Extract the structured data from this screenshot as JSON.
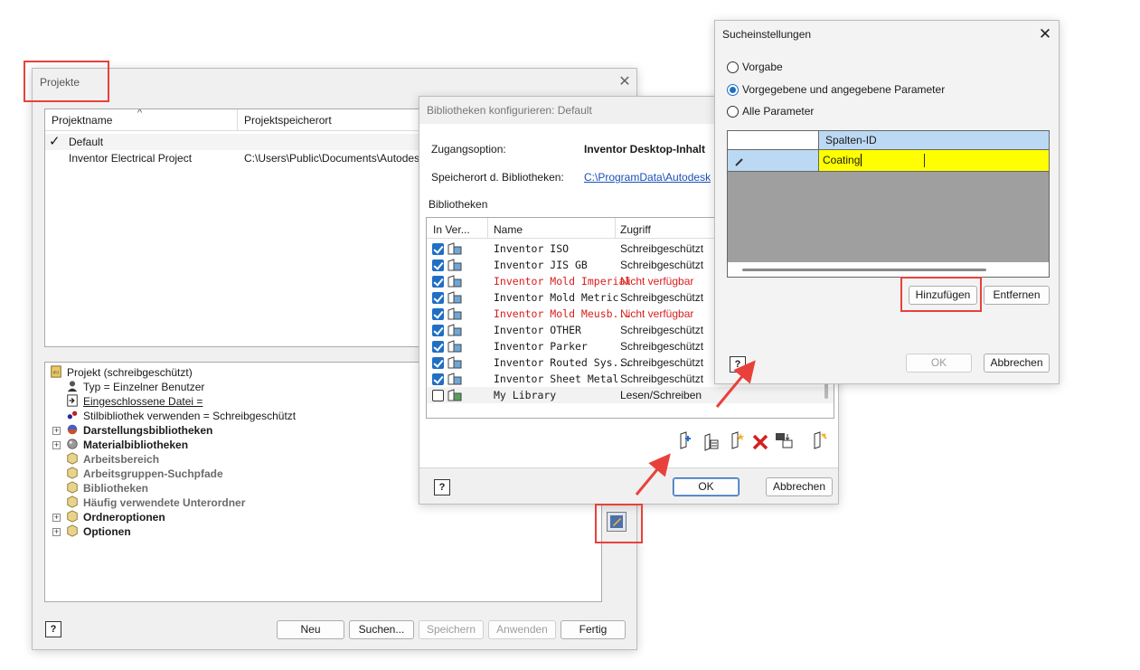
{
  "projekte": {
    "title": "Projekte",
    "columns": [
      "Projektname",
      "Projektspeicherort"
    ],
    "sort_glyph": "^",
    "active_mark": "✓",
    "rows": [
      {
        "name": "Default",
        "path": ""
      },
      {
        "name": "Inventor Electrical Project",
        "path": "C:\\Users\\Public\\Documents\\Autodes"
      }
    ],
    "tree": [
      "Projekt (schreibgeschützt)",
      "Typ = Einzelner Benutzer",
      "Eingeschlossene Datei =",
      "Stilbibliothek verwenden = Schreibgeschützt",
      "Darstellungsbibliotheken",
      "Materialbibliotheken",
      "Arbeitsbereich",
      "Arbeitsgruppen-Suchpfade",
      "Bibliotheken",
      "Häufig verwendete Unterordner",
      "Ordneroptionen",
      "Optionen"
    ],
    "expander_glyph": "+",
    "help_label": "?",
    "buttons": {
      "neu": "Neu",
      "suchen": "Suchen...",
      "speichern": "Speichern",
      "anwenden": "Anwenden",
      "fertig": "Fertig"
    }
  },
  "bibliotheken": {
    "title": "Bibliotheken konfigurieren: Default",
    "zugang_label": "Zugangsoption:",
    "zugang_value": "Inventor Desktop-Inhalt",
    "speicherort_label": "Speicherort d. Bibliotheken:",
    "speicherort_value": "C:\\ProgramData\\Autodesk",
    "section_label": "Bibliotheken",
    "columns": [
      "In Ver...",
      "Name",
      "Zugriff"
    ],
    "rows": [
      {
        "checked": true,
        "name": "Inventor ISO",
        "access": "Schreibgeschützt",
        "unavailable": false
      },
      {
        "checked": true,
        "name": "Inventor JIS GB",
        "access": "Schreibgeschützt",
        "unavailable": false
      },
      {
        "checked": true,
        "name": "Inventor Mold Imperial",
        "access": "Nicht verfügbar",
        "unavailable": true
      },
      {
        "checked": true,
        "name": "Inventor Mold Metric",
        "access": "Schreibgeschützt",
        "unavailable": false
      },
      {
        "checked": true,
        "name": "Inventor Mold Meusb...",
        "access": "Nicht verfügbar",
        "unavailable": true
      },
      {
        "checked": true,
        "name": "Inventor OTHER",
        "access": "Schreibgeschützt",
        "unavailable": false
      },
      {
        "checked": true,
        "name": "Inventor Parker",
        "access": "Schreibgeschützt",
        "unavailable": false
      },
      {
        "checked": true,
        "name": "Inventor Routed Sys...",
        "access": "Schreibgeschützt",
        "unavailable": false
      },
      {
        "checked": true,
        "name": "Inventor Sheet Metal",
        "access": "Schreibgeschützt",
        "unavailable": false
      },
      {
        "checked": false,
        "name": "My Library",
        "access": "Lesen/Schreiben",
        "unavailable": false
      }
    ],
    "help_label": "?",
    "ok": "OK",
    "abbrechen": "Abbrechen"
  },
  "suche": {
    "title": "Sucheinstellungen",
    "radio": [
      "Vorgabe",
      "Vorgegebene und angegebene Parameter",
      "Alle Parameter"
    ],
    "grid_header": "Spalten-ID",
    "grid_value": "Coating",
    "hinzufuegen": "Hinzufügen",
    "entfernen": "Entfernen",
    "help_label": "?",
    "ok": "OK",
    "abbrechen": "Abbrechen"
  },
  "colors": {
    "accent": "#1f6fc5",
    "highlight_red": "#e8413c",
    "unavailable_red": "#d81e1e",
    "grid_yellow": "#ffff00",
    "grid_header_blue": "#bcd9f3"
  }
}
